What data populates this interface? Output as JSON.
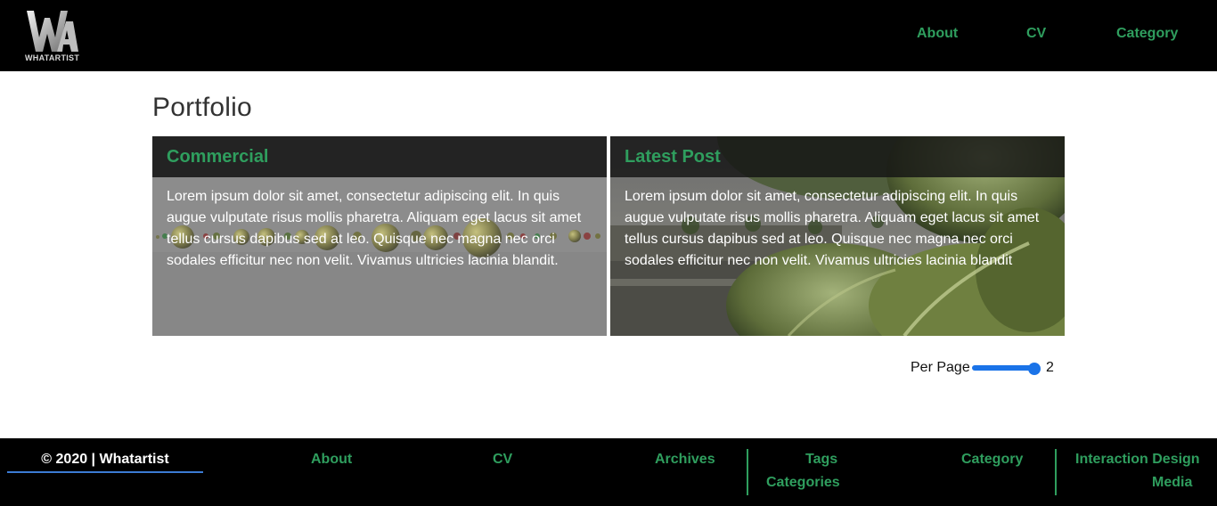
{
  "header": {
    "logo_text": "WHATARTIST",
    "nav": [
      "About",
      "CV",
      "Category"
    ]
  },
  "main": {
    "title": "Portfolio",
    "cards": [
      {
        "title": "Commercial",
        "text": "Lorem ipsum dolor sit amet, consectetur adipiscing elit. In quis augue vulputate risus mollis pharetra. Aliquam eget lacus sit amet tellus cursus dapibus sed at leo. Quisque nec magna nec orci sodales efficitur nec non velit. Vivamus ultricies lacinia blandit."
      },
      {
        "title": "Latest Post",
        "text": "Lorem ipsum dolor sit amet, consectetur adipiscing elit. In quis augue vulputate risus mollis pharetra. Aliquam eget lacus sit amet tellus cursus dapibus sed at leo. Quisque nec magna nec orci sodales efficitur nec non velit. Vivamus ultricies lacinia blandit"
      }
    ],
    "per_page": {
      "label": "Per Page",
      "value": "2",
      "slider_fraction": 1.0
    }
  },
  "footer": {
    "copyright": "© 2020 | Whatartist",
    "links": {
      "about": "About",
      "cv": "CV",
      "archives": "Archives",
      "tags": "Tags",
      "categories": "Categories",
      "category": "Category",
      "interaction_design": "Interaction Design",
      "media": "Media"
    }
  },
  "colors": {
    "accent_green": "#2f9e5e",
    "slider_blue": "#1a73e8",
    "header_bg": "#000000"
  }
}
